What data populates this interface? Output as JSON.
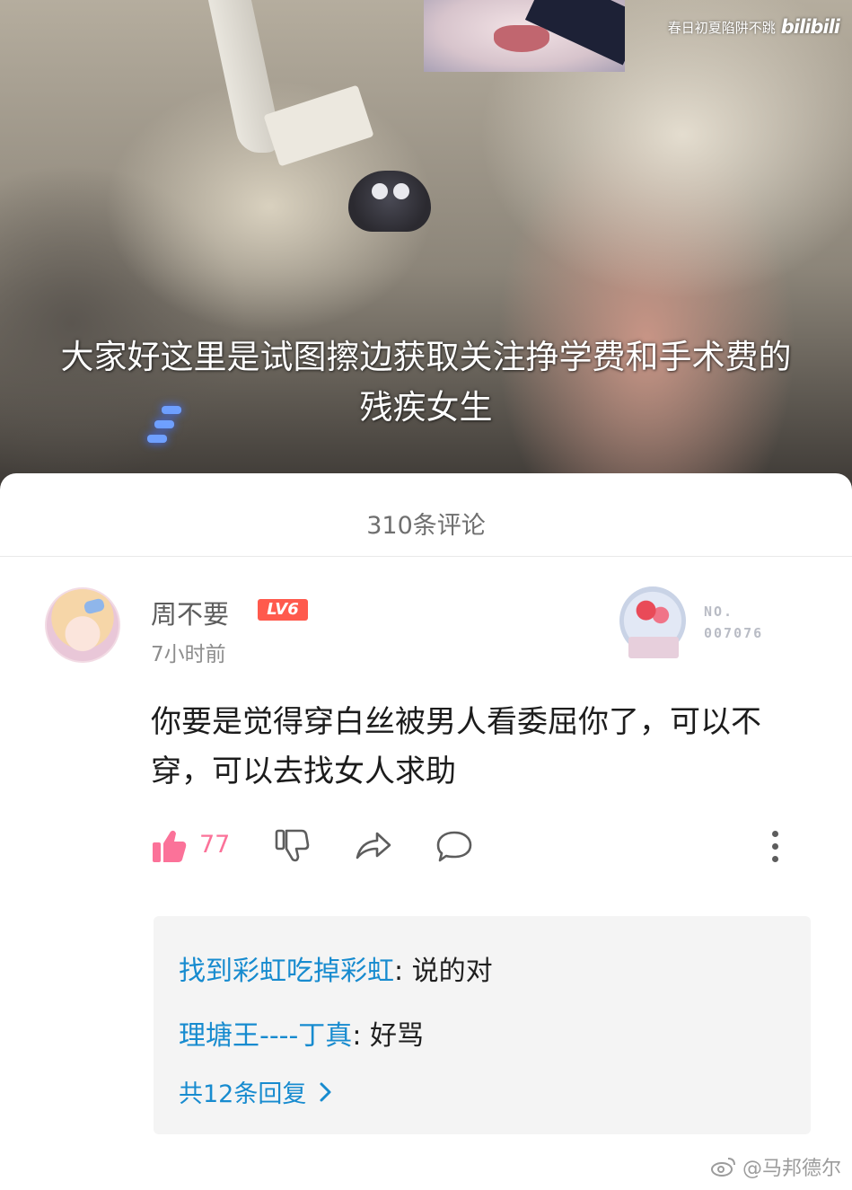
{
  "video": {
    "watermark_channel": "春日初夏陷阱不跳",
    "watermark_logo": "bilibili",
    "caption_line1": "大家好这里是试图擦边获取关注挣学费和手术费的",
    "caption_line2": "残疾女生"
  },
  "comments_header": {
    "count_label": "310条评论"
  },
  "comment": {
    "username": "周不要",
    "level": "LV6",
    "time": "7小时前",
    "medal_no_label": "NO.",
    "medal_no_value": "007076",
    "text": "你要是觉得穿白丝被男人看委屈你了，可以不穿，可以去找女人求助",
    "likes": "77"
  },
  "replies": [
    {
      "author": "找到彩虹吃掉彩虹",
      "sep": ": ",
      "text": "说的对"
    },
    {
      "author": "理塘王----丁真",
      "sep": ": ",
      "text": "好骂"
    }
  ],
  "replies_total": "共12条回复",
  "footer": {
    "watermark": "@马邦德尔"
  },
  "colors": {
    "accent_pink": "#fb7299",
    "link_blue": "#178bcf",
    "level_red": "#ff5a4d"
  },
  "icons": [
    "thumb-up-icon",
    "thumb-down-icon",
    "share-icon",
    "comment-bubble-icon",
    "more-vertical-icon",
    "chevron-right-icon",
    "weibo-icon"
  ]
}
